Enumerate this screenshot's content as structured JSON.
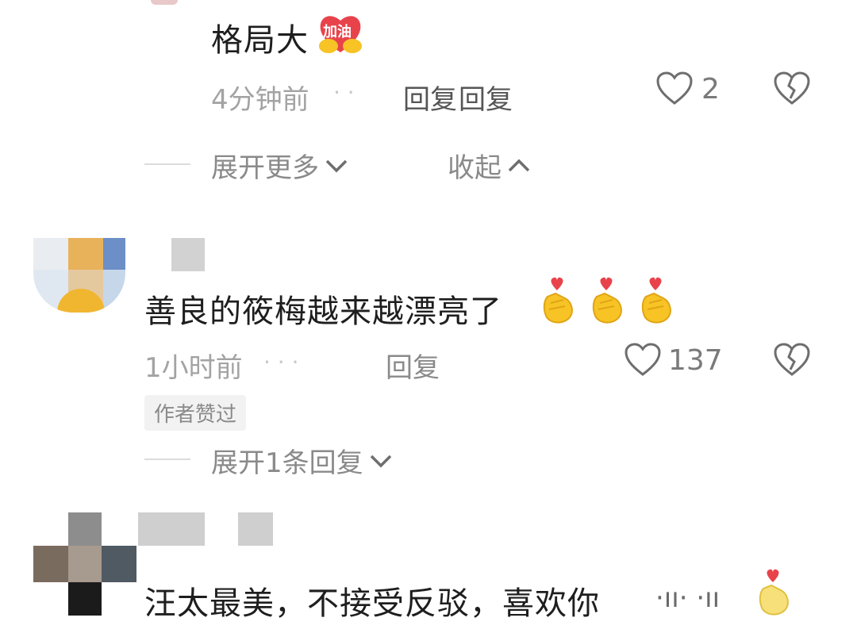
{
  "comments": [
    {
      "text": "格局大",
      "emoji_badge": "加油",
      "time": "4分钟前",
      "reply": "回复",
      "reply_overlap": "回复",
      "likes": "2"
    },
    {
      "text": "善良的筱梅越来越漂亮了",
      "time": "1小时前",
      "reply": "回复",
      "likes": "137",
      "author_badge": "作者赞过",
      "expand": "展开1条回复"
    },
    {
      "text": "汪太最美，不接受反驳，喜欢你"
    }
  ],
  "thread_controls": {
    "expand_more": "展开更多",
    "collapse": "收起"
  },
  "icons": {
    "like": "heart-outline-icon",
    "dislike": "broken-heart-icon",
    "chevron_down": "chevron-down-icon",
    "chevron_up": "chevron-up-icon",
    "emoji": "finger-heart-emoji-icon"
  },
  "colors": {
    "text": "#1e1e1e",
    "meta": "#a3a3a3",
    "secondary": "#8a8a8a",
    "emoji_red": "#e8434b",
    "emoji_yellow": "#f7c325"
  }
}
